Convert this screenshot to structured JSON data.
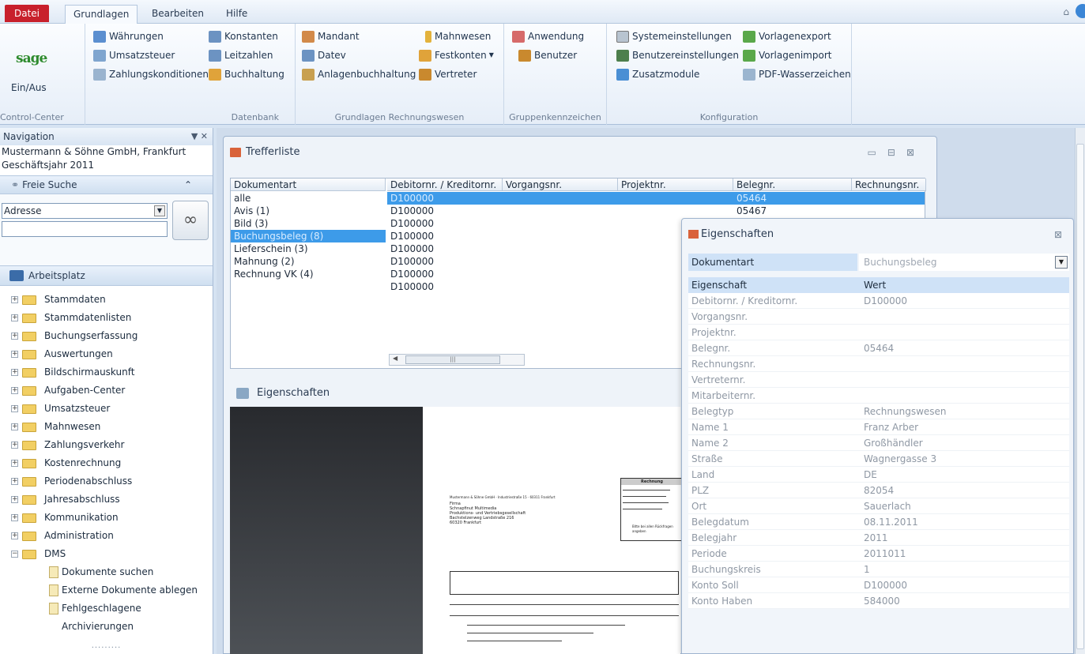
{
  "tabs": {
    "file": "Datei",
    "items": [
      "Grundlagen",
      "Bearbeiten",
      "Hilfe"
    ],
    "active": "Grundlagen"
  },
  "ribbon": {
    "logo": "sage",
    "control_center": {
      "button": "Ein/Aus",
      "title": "Control-Center"
    },
    "datenbank": {
      "title": "Datenbank",
      "items": [
        "Währungen",
        "Umsatzsteuer",
        "Zahlungskonditionen",
        "Konstanten",
        "Leitzahlen",
        "Buchhaltung"
      ]
    },
    "grundlagen_rw": {
      "title": "Grundlagen Rechnungswesen",
      "items": [
        "Mandant",
        "Datev",
        "Anlagenbuchhaltung",
        "Mahnwesen",
        "Festkonten",
        "Vertreter"
      ]
    },
    "gruppenkennzeichen": {
      "title": "Gruppenkennzeichen",
      "items": [
        "Anwendung",
        "Benutzer"
      ]
    },
    "konfiguration": {
      "title": "Konfiguration",
      "items": [
        "Systemeinstellungen",
        "Benutzereinstellungen",
        "Zusatzmodule",
        "Vorlagenexport",
        "Vorlagenimport",
        "PDF-Wasserzeichen"
      ]
    }
  },
  "nav": {
    "title": "Navigation",
    "controls": "▼ ✕",
    "company": "Mustermann & Söhne GmbH, Frankfurt",
    "year": "Geschäftsjahr 2011",
    "freie_suche": "Freie Suche",
    "search_combo_value": "Adresse",
    "arbeitsplatz": "Arbeitsplatz",
    "tree": [
      "Stammdaten",
      "Stammdatenlisten",
      "Buchungserfassung",
      "Auswertungen",
      "Bildschirmauskunft",
      "Aufgaben-Center",
      "Umsatzsteuer",
      "Mahnwesen",
      "Zahlungsverkehr",
      "Kostenrechnung",
      "Periodenabschluss",
      "Jahresabschluss",
      "Kommunikation",
      "Administration",
      "DMS"
    ],
    "dms_children": [
      "Dokumente suchen",
      "Externe Dokumente ablegen",
      "Fehlgeschlagene Archivierungen"
    ],
    "footer": "........."
  },
  "trefferliste": {
    "title": "Trefferliste",
    "headers": [
      "Dokumentart",
      "Debitornr. / Kreditornr.",
      "Vorgangsnr.",
      "Projektnr.",
      "Belegnr.",
      "Rechnungsnr."
    ],
    "doctypes": [
      "alle",
      "Avis (1)",
      "Bild (3)",
      "Buchungsbeleg (8)",
      "Lieferschein (3)",
      "Mahnung (2)",
      "Rechnung VK (4)"
    ],
    "selected_doctype": 3,
    "debitor": [
      "D100000",
      "D100000",
      "D100000",
      "D100000",
      "D100000",
      "D100000",
      "D100000",
      "D100000"
    ],
    "belegnr": [
      "05464",
      "05467"
    ]
  },
  "eigenschaften_panel": {
    "title": "Eigenschaften"
  },
  "preview": {
    "sender": "Mustermann & Söhne GmbH · Industriestraße 15 · 60311 Frankfurt",
    "address": [
      "Firma",
      "Schnapfinut Multimedia",
      "Produktions- und Vertriebsgesellschaft",
      "Bachstelzenweg Landstraße 216",
      "60320 Frankfurt"
    ],
    "box_title": "Rechnung",
    "thanks": "Bitte bei allen Rückfragen angeben"
  },
  "eigenschaften": {
    "title": "Eigenschaften",
    "dokumentart_label": "Dokumentart",
    "dokumentart_value": "Buchungsbeleg",
    "col_prop": "Eigenschaft",
    "col_val": "Wert",
    "rows": [
      {
        "k": "Debitornr. / Kreditornr.",
        "v": "D100000"
      },
      {
        "k": "Vorgangsnr.",
        "v": ""
      },
      {
        "k": "Projektnr.",
        "v": ""
      },
      {
        "k": "Belegnr.",
        "v": "05464"
      },
      {
        "k": "Rechnungsnr.",
        "v": ""
      },
      {
        "k": "Vertreternr.",
        "v": ""
      },
      {
        "k": "Mitarbeiternr.",
        "v": ""
      },
      {
        "k": "Belegtyp",
        "v": "Rechnungswesen"
      },
      {
        "k": "Name 1",
        "v": "Franz Arber"
      },
      {
        "k": "Name 2",
        "v": "Großhändler"
      },
      {
        "k": "Straße",
        "v": "Wagnergasse 3"
      },
      {
        "k": "Land",
        "v": "DE"
      },
      {
        "k": "PLZ",
        "v": "82054"
      },
      {
        "k": "Ort",
        "v": "Sauerlach"
      },
      {
        "k": "Belegdatum",
        "v": "08.11.2011"
      },
      {
        "k": "Belegjahr",
        "v": "2011"
      },
      {
        "k": "Periode",
        "v": "2011011"
      },
      {
        "k": "Buchungskreis",
        "v": "1"
      },
      {
        "k": "Konto Soll",
        "v": "D100000"
      },
      {
        "k": "Konto Haben",
        "v": "584000"
      }
    ]
  }
}
